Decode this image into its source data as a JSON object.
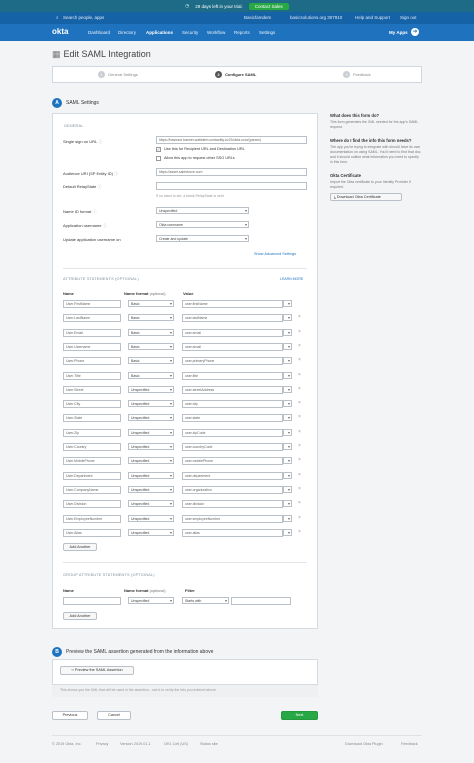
{
  "trial": {
    "text": "29 days left in your trial.",
    "cta": "Contact Sales"
  },
  "topbar": {
    "search": "Search people, apps",
    "user": "Basicfamdem",
    "org": "basicsolutions.org 307910",
    "help": "Help and Support",
    "signout": "Sign out"
  },
  "nav": {
    "logo": "okta",
    "items": [
      "Dashboard",
      "Directory",
      "Applications",
      "Security",
      "Workflow",
      "Reports",
      "Settings"
    ],
    "myapps": "My Apps"
  },
  "page": {
    "title": "Edit SAML Integration"
  },
  "steps": [
    {
      "num": "1",
      "label": "General Settings"
    },
    {
      "num": "2",
      "label": "Configure SAML"
    },
    {
      "num": "3",
      "label": "Feedback"
    }
  ],
  "sectionA": {
    "letter": "A",
    "title": "SAML Settings"
  },
  "general": {
    "heading": "GENERAL",
    "sso_label": "Single sign on URL",
    "sso_value": "https://basicsol.banner.wallstem.contactlty.io/23/okta.com/(param)",
    "chk1": "Use this for Recipient URL and Destination URL",
    "chk2": "Allow this app to request other SSO URLs",
    "audience_label": "Audience URI (SP Entity ID)",
    "audience_value": "https://asset.salesforce.com",
    "relay_label": "Default RelayState",
    "relay_hint": "If no value is set, a blank RelayState is sent",
    "nameid_label": "Name ID format",
    "nameid_value": "Unspecified",
    "username_label": "Application username",
    "username_value": "Okta username",
    "update_label": "Update application username on",
    "update_value": "Create and update",
    "advanced": "Show Advanced Settings"
  },
  "attr": {
    "heading": "ATTRIBUTE STATEMENTS (OPTIONAL)",
    "learn": "LEARN MORE",
    "col_name": "Name",
    "col_format": "Name format",
    "col_optional": "(optional)",
    "col_value": "Value",
    "rows": [
      {
        "name": "User.FirstName",
        "format": "Basic",
        "value": "user.firstName"
      },
      {
        "name": "User.LastName",
        "format": "Basic",
        "value": "user.lastName"
      },
      {
        "name": "User.Email",
        "format": "Basic",
        "value": "user.email"
      },
      {
        "name": "User.Username",
        "format": "Basic",
        "value": "user.email"
      },
      {
        "name": "User.Phone",
        "format": "Basic",
        "value": "user.primaryPhone"
      },
      {
        "name": "User.Title",
        "format": "Basic",
        "value": "user.title"
      },
      {
        "name": "User.Street",
        "format": "Unspecified",
        "value": "user.streetAddress"
      },
      {
        "name": "User.City",
        "format": "Unspecified",
        "value": "user.city"
      },
      {
        "name": "User.State",
        "format": "Unspecified",
        "value": "user.state"
      },
      {
        "name": "User.Zip",
        "format": "Unspecified",
        "value": "user.zipCode"
      },
      {
        "name": "User.Country",
        "format": "Unspecified",
        "value": "user.countryCode"
      },
      {
        "name": "User.MobilePhone",
        "format": "Unspecified",
        "value": "user.mobilePhone"
      },
      {
        "name": "User.Department",
        "format": "Unspecified",
        "value": "user.department"
      },
      {
        "name": "User.CompanyName",
        "format": "Unspecified",
        "value": "user.organization"
      },
      {
        "name": "User.Division",
        "format": "Unspecified",
        "value": "user.division"
      },
      {
        "name": "User.EmployeeNumber",
        "format": "Unspecified",
        "value": "user.employeeNumber"
      },
      {
        "name": "User.Alias",
        "format": "Unspecified",
        "value": "user.alias"
      }
    ],
    "add": "Add Another"
  },
  "group": {
    "heading": "GROUP ATTRIBUTE STATEMENTS (OPTIONAL)",
    "col_name": "Name",
    "col_format": "Name format",
    "col_optional": "(optional)",
    "col_filter": "Filter",
    "format_value": "Unspecified",
    "filter_value": "Starts with",
    "add": "Add Another"
  },
  "sectionB": {
    "letter": "B",
    "title": "Preview the SAML assertion generated from the information above",
    "button": "Preview the SAML Assertion",
    "note": "This shows you the XML that will be used in the assertion - use it to verify the info you entered above"
  },
  "buttons": {
    "previous": "Previous",
    "cancel": "Cancel",
    "next": "Next"
  },
  "help": {
    "q1": "What does this form do?",
    "a1": "This form generates the XML needed for the app's SAML request.",
    "q2": "Where do I find the info this form needs?",
    "a2": "The app you're trying to integrate with should have its own documentation on using SAML. You'll need to find that doc, and it should outline what information you need to specify in this form.",
    "cert_t": "Okta Certificate",
    "cert_p": "Import the Okta certificate to your Identity Provider if required.",
    "cert_btn": "Download Okta Certificate"
  },
  "footer": {
    "copy": "© 2019 Okta, Inc.",
    "privacy": "Privacy",
    "version": "Version 2019.01.1",
    "cell": "OK1 Cell (US)",
    "status": "Status site",
    "plugin": "Download Okta Plugin",
    "feedback": "Feedback"
  },
  "colors": {
    "nav": "#1f73be",
    "topbar": "#1662a6",
    "trial": "#1d6b86",
    "next": "#28a745"
  }
}
